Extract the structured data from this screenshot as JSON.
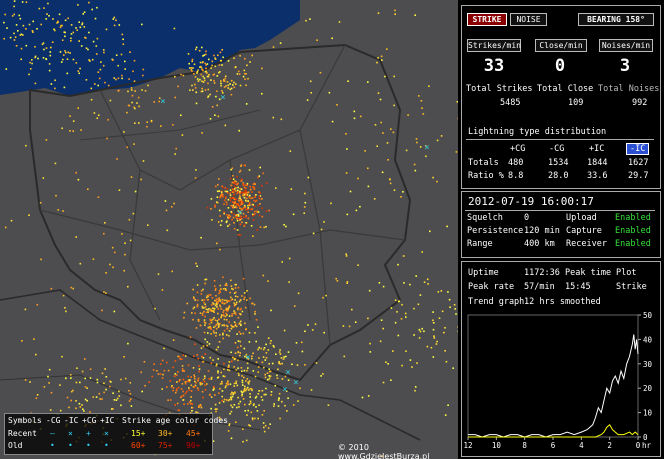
{
  "map": {
    "copyright": "© 2010 www.GdzieJestBurza.pl",
    "legend": {
      "symbols_label": "Symbols",
      "types": [
        "-CG",
        "-IC",
        "+CG",
        "+IC"
      ],
      "recent_label": "Recent",
      "old_label": "Old",
      "recent_symbols": [
        "—",
        "×",
        "+",
        "×"
      ],
      "old_symbols": [
        "•",
        "•",
        "•",
        "•"
      ],
      "age_title": "Strike age color codes",
      "age_recent": [
        "15+",
        "30+",
        "45+"
      ],
      "age_old": [
        "60+",
        "75+",
        "90+"
      ],
      "age_colors": [
        "#ffff33",
        "#ffbb22",
        "#ff7711",
        "#ff4400",
        "#dd2200",
        "#bb0000"
      ]
    }
  },
  "panel": {
    "tabs": {
      "strike": "STRIKE",
      "noise": "NOISE",
      "bearing": "BEARING 158°"
    },
    "rates": [
      {
        "label": "Strikes/min",
        "value": "33"
      },
      {
        "label": "Close/min",
        "value": "0"
      },
      {
        "label": "Noises/min",
        "value": "3"
      }
    ],
    "totals": [
      {
        "label": "Total Strikes",
        "value": "5485"
      },
      {
        "label": "Total Close",
        "value": "109"
      },
      {
        "label": "Total Noises",
        "value": "992"
      }
    ],
    "distribution": {
      "title": "Lightning type distribution",
      "columns": [
        "+CG",
        "-CG",
        "+IC",
        "-IC"
      ],
      "rows": [
        {
          "label": "Totals",
          "values": [
            "480",
            "1534",
            "1844",
            "1627"
          ]
        },
        {
          "label": "Ratio %",
          "values": [
            "8.8",
            "28.0",
            "33.6",
            "29.7"
          ]
        }
      ]
    },
    "datetime": "2012-07-19 16:00:17",
    "settings": [
      {
        "label": "Squelch",
        "value": "0",
        "label2": "Upload",
        "value2": "Enabled"
      },
      {
        "label": "Persistence",
        "value": "120 min",
        "label2": "Capture",
        "value2": "Enabled"
      },
      {
        "label": "Range",
        "value": "400 km",
        "label2": "Receiver",
        "value2": "Enabled"
      }
    ],
    "stats": {
      "uptime_label": "Uptime",
      "uptime_value": "1172:36",
      "peak_time_label": "Peak time",
      "plot_label": "Plot",
      "peak_rate_label": "Peak rate",
      "peak_rate_value": "57/min",
      "peak_time_value": "15:45",
      "plot_value": "Strike",
      "trend_label": "Trend graph",
      "trend_value": "12 hrs smoothed"
    }
  },
  "chart_data": {
    "type": "area",
    "xlabel": "hr",
    "x_ticks": [
      "12",
      "10",
      "8",
      "6",
      "4",
      "2",
      "0"
    ],
    "y_ticks": [
      "0",
      "10",
      "20",
      "30",
      "40",
      "50"
    ],
    "xlim": [
      12,
      0
    ],
    "ylim": [
      0,
      50
    ],
    "series": [
      {
        "color": "#ffffff",
        "x": [
          12,
          11.5,
          11,
          10.5,
          10,
          9.5,
          9,
          8.5,
          8,
          7.5,
          7,
          6.5,
          6,
          5.5,
          5,
          4.5,
          4,
          3.6,
          3.2,
          3.0,
          2.8,
          2.6,
          2.4,
          2.2,
          2.0,
          1.8,
          1.6,
          1.4,
          1.2,
          1.0,
          0.8,
          0.6,
          0.4,
          0.3,
          0.2,
          0.1,
          0
        ],
        "values": [
          1,
          1,
          0,
          1,
          1,
          0,
          1,
          1,
          0,
          1,
          1,
          0,
          1,
          1,
          2,
          1,
          2,
          3,
          5,
          8,
          12,
          10,
          15,
          20,
          18,
          23,
          25,
          22,
          27,
          24,
          30,
          33,
          38,
          42,
          36,
          40,
          34
        ]
      },
      {
        "color": "#ffff00",
        "x": [
          12,
          3,
          2.6,
          2.4,
          2.2,
          2.0,
          1.8,
          1.6,
          1.4,
          1.0,
          0.6,
          0.4,
          0.2,
          0
        ],
        "values": [
          0,
          0,
          1,
          2,
          4,
          5,
          3,
          2,
          1,
          1,
          2,
          1,
          2,
          1
        ]
      }
    ]
  }
}
